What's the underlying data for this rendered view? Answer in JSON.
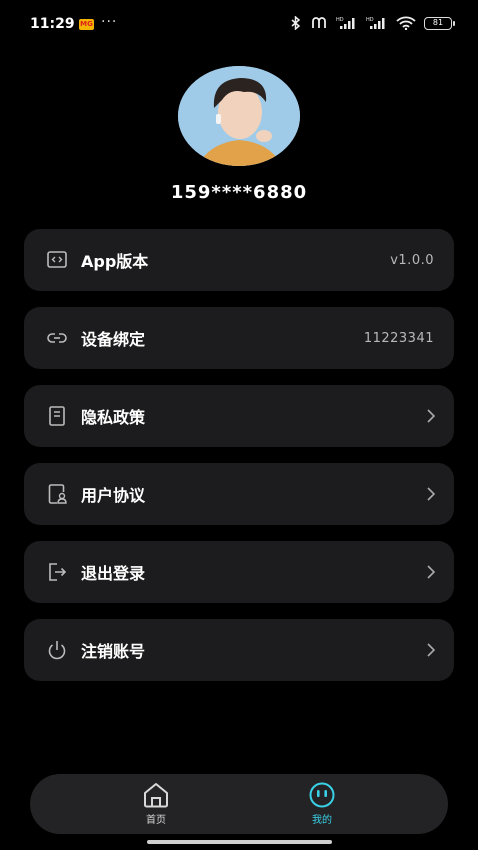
{
  "status_bar": {
    "time": "11:29",
    "app_badge": "MG",
    "overflow": "···",
    "battery": "81"
  },
  "profile": {
    "phone": "159****6880"
  },
  "menu": {
    "items": [
      {
        "label": "App版本",
        "value": "v1.0.0",
        "icon": "code-icon"
      },
      {
        "label": "设备绑定",
        "value": "11223341",
        "icon": "link-icon"
      },
      {
        "label": "隐私政策",
        "icon": "document-icon"
      },
      {
        "label": "用户协议",
        "icon": "user-doc-icon"
      },
      {
        "label": "退出登录",
        "icon": "logout-icon"
      },
      {
        "label": "注销账号",
        "icon": "power-icon"
      }
    ]
  },
  "bottom_nav": {
    "tabs": [
      {
        "label": "首页",
        "icon": "home-icon"
      },
      {
        "label": "我的",
        "icon": "smiley-icon",
        "active": true
      }
    ],
    "active_color": "#3ad0e6"
  }
}
